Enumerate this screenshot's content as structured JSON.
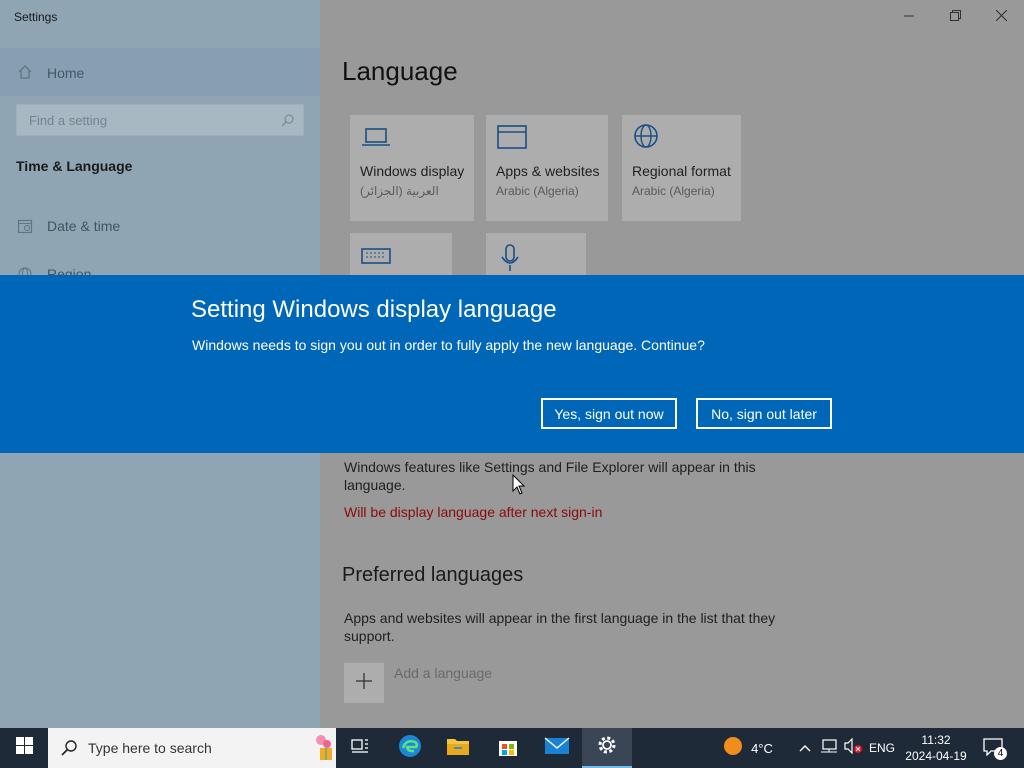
{
  "window": {
    "title": "Settings",
    "controls": [
      "minimize-icon",
      "restore-icon",
      "close-icon"
    ]
  },
  "sidebar": {
    "home_label": "Home",
    "search_placeholder": "Find a setting",
    "section_title": "Time & Language",
    "items": [
      {
        "label": "Date & time",
        "icon": "date-time-icon"
      },
      {
        "label": "Region",
        "icon": "region-icon"
      }
    ]
  },
  "main": {
    "title": "Language",
    "tiles": [
      {
        "title": "Windows display",
        "subtitle": "العربية (الجزائر)",
        "icon": "laptop-icon"
      },
      {
        "title": "Apps & websites",
        "subtitle": "Arabic (Algeria)",
        "icon": "window-icon"
      },
      {
        "title": "Regional format",
        "subtitle": "Arabic (Algeria)",
        "icon": "globe-icon"
      },
      {
        "title": "",
        "subtitle": "",
        "icon": "keyboard-icon"
      },
      {
        "title": "",
        "subtitle": "",
        "icon": "microphone-icon"
      }
    ],
    "display_desc": "Windows features like Settings and File Explorer will appear in this language.",
    "display_note": "Will be display language after next sign-in",
    "preferred_title": "Preferred languages",
    "preferred_desc": "Apps and websites will appear in the first language in the list that they support.",
    "add_language": "Add a language"
  },
  "dialog": {
    "title": "Setting Windows display language",
    "message": "Windows needs to sign you out in order to fully apply the new language. Continue?",
    "yes_label": "Yes, sign out now",
    "no_label": "No, sign out later"
  },
  "taskbar": {
    "search_placeholder": "Type here to search",
    "weather_temp": "4°C",
    "language": "ENG",
    "time": "11:32",
    "date": "2024-04-19",
    "notification_count": "4"
  }
}
